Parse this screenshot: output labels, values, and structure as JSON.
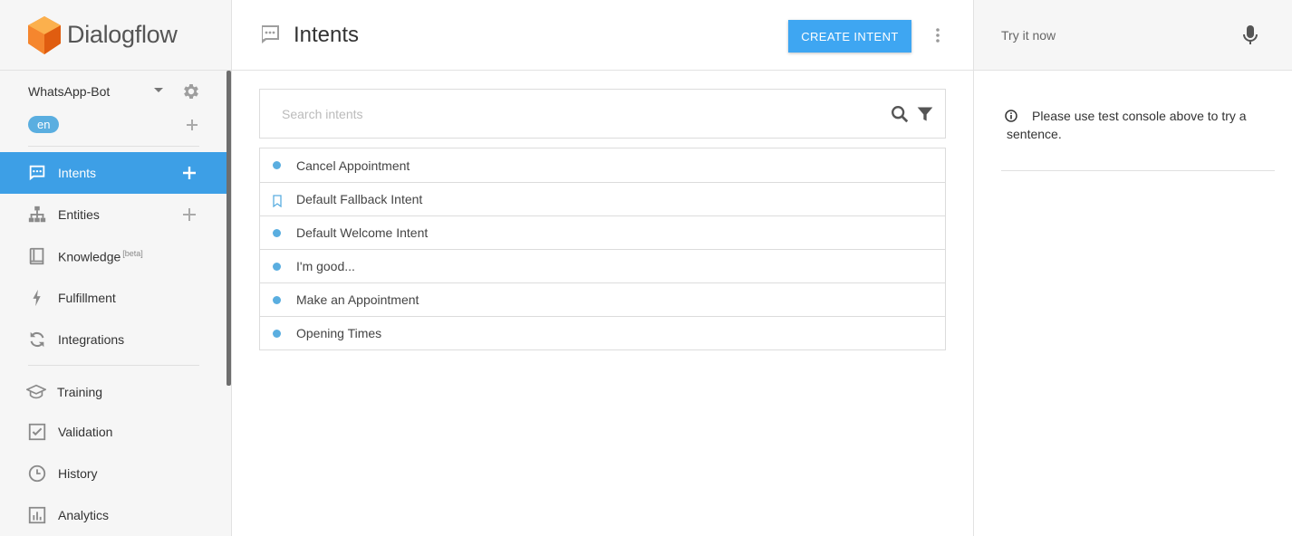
{
  "brand": {
    "name": "Dialogflow",
    "logo_color": "#f57c22"
  },
  "agent": {
    "name": "WhatsApp-Bot",
    "language": "en"
  },
  "nav": {
    "items": [
      {
        "label": "Intents",
        "icon": "chat-icon",
        "active": true
      },
      {
        "label": "Entities",
        "icon": "hierarchy-icon"
      },
      {
        "label": "Knowledge",
        "badge": "[beta]",
        "icon": "book-icon"
      },
      {
        "label": "Fulfillment",
        "icon": "bolt-icon"
      },
      {
        "label": "Integrations",
        "icon": "sync-icon"
      },
      {
        "label": "Training",
        "icon": "graduation-cap-icon"
      },
      {
        "label": "Validation",
        "icon": "checkbox-icon"
      },
      {
        "label": "History",
        "icon": "clock-icon"
      },
      {
        "label": "Analytics",
        "icon": "bar-chart-icon"
      }
    ]
  },
  "header": {
    "title": "Intents",
    "create_label": "CREATE INTENT"
  },
  "search": {
    "placeholder": "Search intents",
    "value": ""
  },
  "intents": [
    {
      "name": "Cancel Appointment",
      "marker": "dot"
    },
    {
      "name": "Default Fallback Intent",
      "marker": "bookmark"
    },
    {
      "name": "Default Welcome Intent",
      "marker": "dot"
    },
    {
      "name": "I'm good...",
      "marker": "dot"
    },
    {
      "name": "Make an Appointment",
      "marker": "dot"
    },
    {
      "name": "Opening Times",
      "marker": "dot"
    }
  ],
  "test_console": {
    "placeholder": "Try it now",
    "info_text": "Please use test console above to try a sentence."
  },
  "colors": {
    "accent": "#3d9fe6",
    "button": "#3ea6f2",
    "chip": "#5aaee0"
  }
}
